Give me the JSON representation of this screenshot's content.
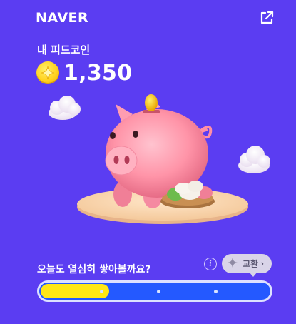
{
  "brand": "NAVER",
  "external_link_icon": "external-link-icon",
  "title": "내 피드코인",
  "coin": {
    "icon": "coin-sparkle-icon",
    "balance": "1,350"
  },
  "prompt": "오늘도 열심히 쌓아볼까요?",
  "exchange": {
    "label": "교환",
    "chevron": "›",
    "icon": "sparkle-icon"
  },
  "info": {
    "glyph": "i",
    "icon": "info-icon"
  },
  "progress": {
    "value": 0.3,
    "fill_color": "#ffe714",
    "track_color": "#2459ff",
    "checkpoints": [
      0.26,
      0.51,
      0.76
    ]
  },
  "colors": {
    "background": "#5b3df2",
    "accent": "#ffe714"
  }
}
